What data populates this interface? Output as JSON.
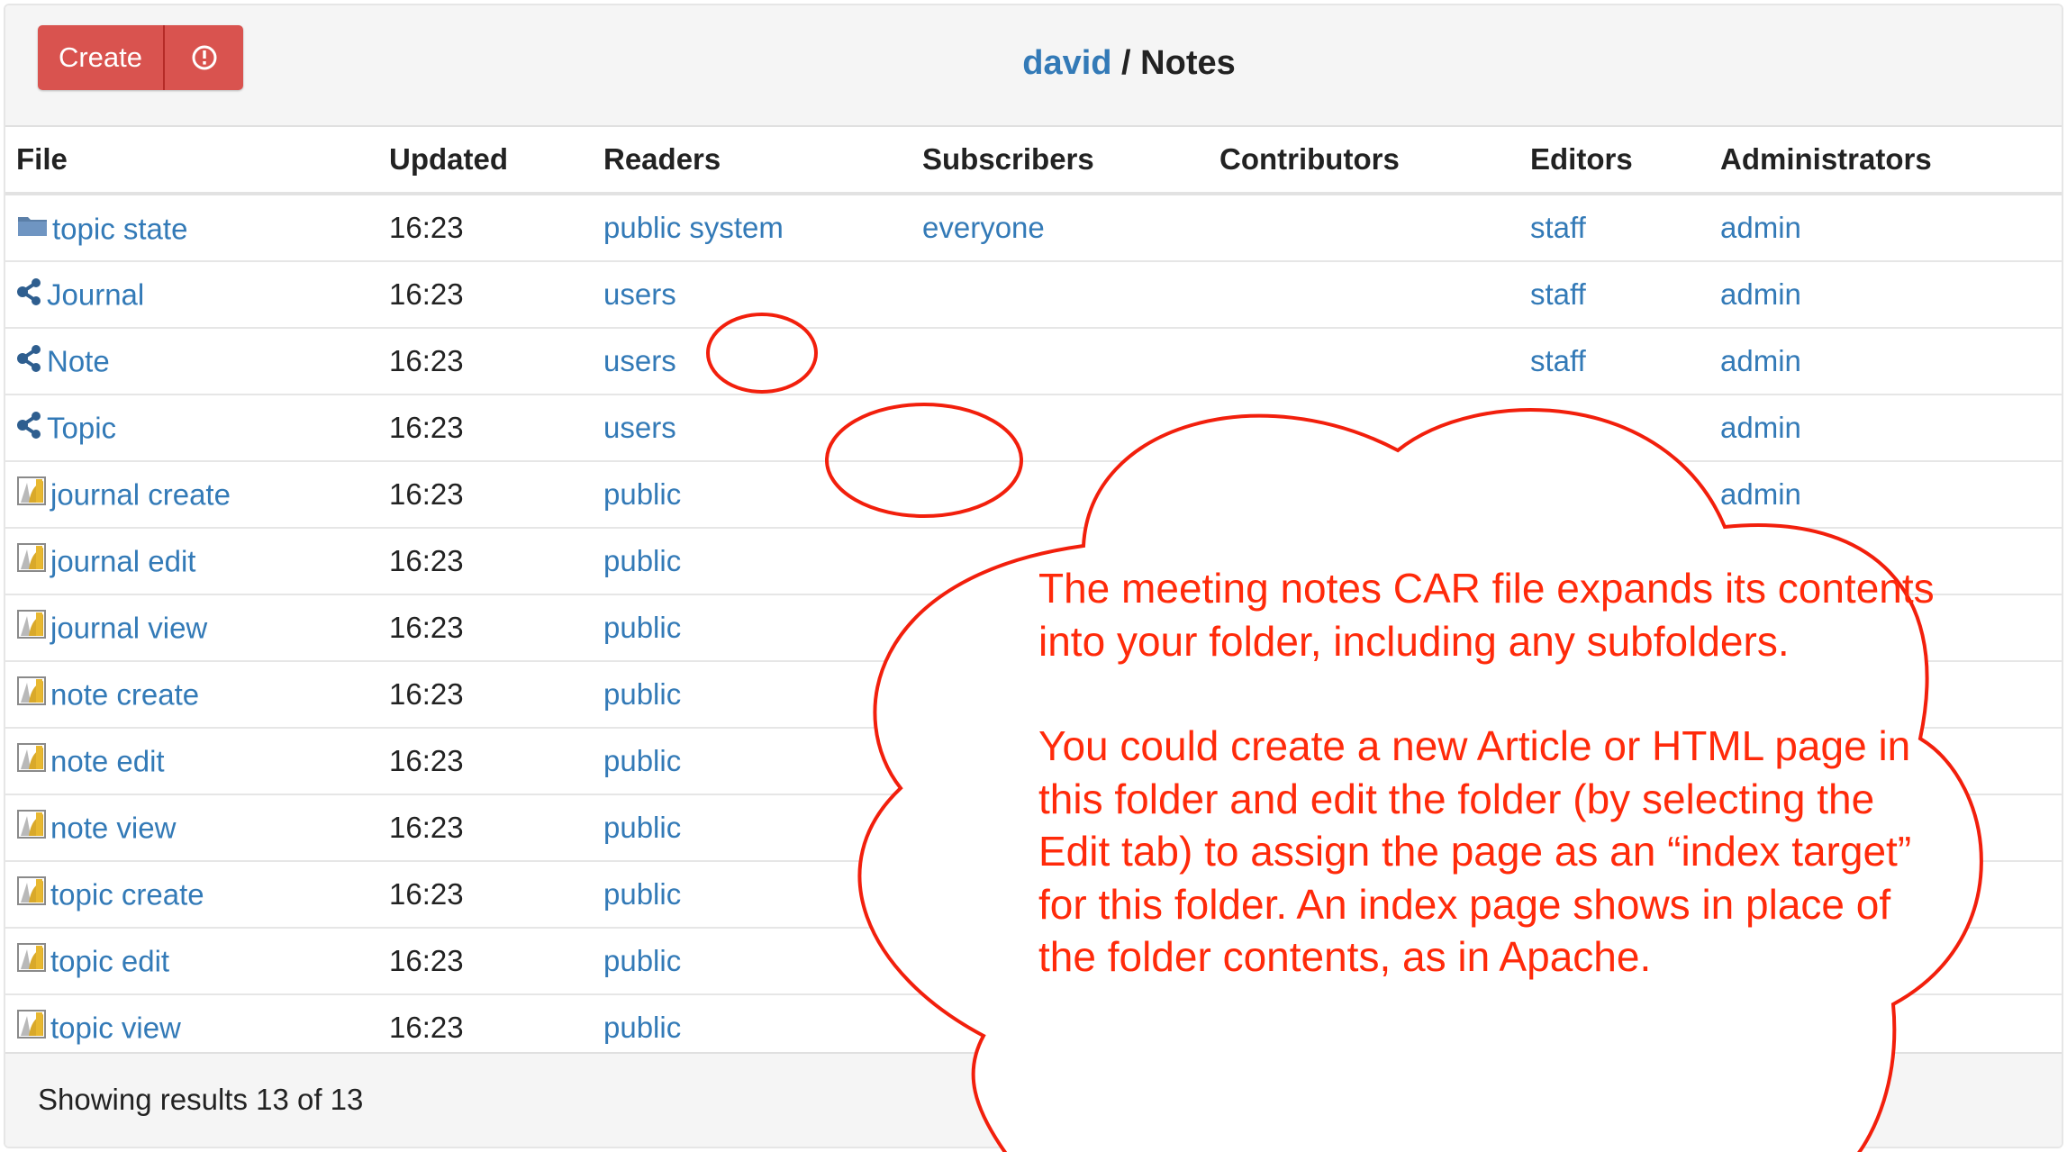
{
  "header": {
    "create_label": "Create",
    "toggle_icon": "info-circle-icon",
    "breadcrumb_user": "david",
    "breadcrumb_sep": " / ",
    "breadcrumb_folder": "Notes"
  },
  "columns": [
    "File",
    "Updated",
    "Readers",
    "Subscribers",
    "Contributors",
    "Editors",
    "Administrators"
  ],
  "rows": [
    {
      "icon": "folder-icon",
      "name": "topic state",
      "updated": "16:23",
      "readers": "public system",
      "subscribers": "everyone",
      "contributors": "",
      "editors": "staff",
      "administrators": "admin"
    },
    {
      "icon": "share-icon",
      "name": "Journal",
      "updated": "16:23",
      "readers": "users",
      "subscribers": "",
      "contributors": "",
      "editors": "staff",
      "administrators": "admin"
    },
    {
      "icon": "share-icon",
      "name": "Note",
      "updated": "16:23",
      "readers": "users",
      "subscribers": "",
      "contributors": "",
      "editors": "staff",
      "administrators": "admin"
    },
    {
      "icon": "share-icon",
      "name": "Topic",
      "updated": "16:23",
      "readers": "users",
      "subscribers": "",
      "contributors": "",
      "editors": "",
      "administrators": "admin"
    },
    {
      "icon": "template-icon",
      "name": "journal create",
      "updated": "16:23",
      "readers": "public",
      "subscribers": "",
      "contributors": "",
      "editors": "",
      "administrators": "admin"
    },
    {
      "icon": "template-icon",
      "name": "journal edit",
      "updated": "16:23",
      "readers": "public",
      "subscribers": "",
      "contributors": "",
      "editors": "",
      "administrators": ""
    },
    {
      "icon": "template-icon",
      "name": "journal view",
      "updated": "16:23",
      "readers": "public",
      "subscribers": "",
      "contributors": "",
      "editors": "",
      "administrators": ""
    },
    {
      "icon": "template-icon",
      "name": "note create",
      "updated": "16:23",
      "readers": "public",
      "subscribers": "",
      "contributors": "",
      "editors": "",
      "administrators": ""
    },
    {
      "icon": "template-icon",
      "name": "note edit",
      "updated": "16:23",
      "readers": "public",
      "subscribers": "",
      "contributors": "",
      "editors": "",
      "administrators": ""
    },
    {
      "icon": "template-icon",
      "name": "note view",
      "updated": "16:23",
      "readers": "public",
      "subscribers": "",
      "contributors": "",
      "editors": "",
      "administrators": ""
    },
    {
      "icon": "template-icon",
      "name": "topic create",
      "updated": "16:23",
      "readers": "public",
      "subscribers": "",
      "contributors": "",
      "editors": "",
      "administrators": ""
    },
    {
      "icon": "template-icon",
      "name": "topic edit",
      "updated": "16:23",
      "readers": "public",
      "subscribers": "",
      "contributors": "",
      "editors": "",
      "administrators": ""
    },
    {
      "icon": "template-icon",
      "name": "topic view",
      "updated": "16:23",
      "readers": "public",
      "subscribers": "",
      "contributors": "",
      "editors": "",
      "administrators": ""
    }
  ],
  "footer": {
    "status": "Showing results 13 of 13"
  },
  "annotation": {
    "paragraph1": "The meeting notes CAR file expands its contents into your folder, including any subfolders.",
    "paragraph2": "You could create a new Article or HTML page in this folder and edit the folder (by selecting the Edit tab) to assign the page as an “index target” for this folder. An index page shows in place of the folder contents, as in Apache."
  },
  "colors": {
    "accent": "#337ab7",
    "create": "#d9534f",
    "annotation": "#ff2a0a"
  }
}
